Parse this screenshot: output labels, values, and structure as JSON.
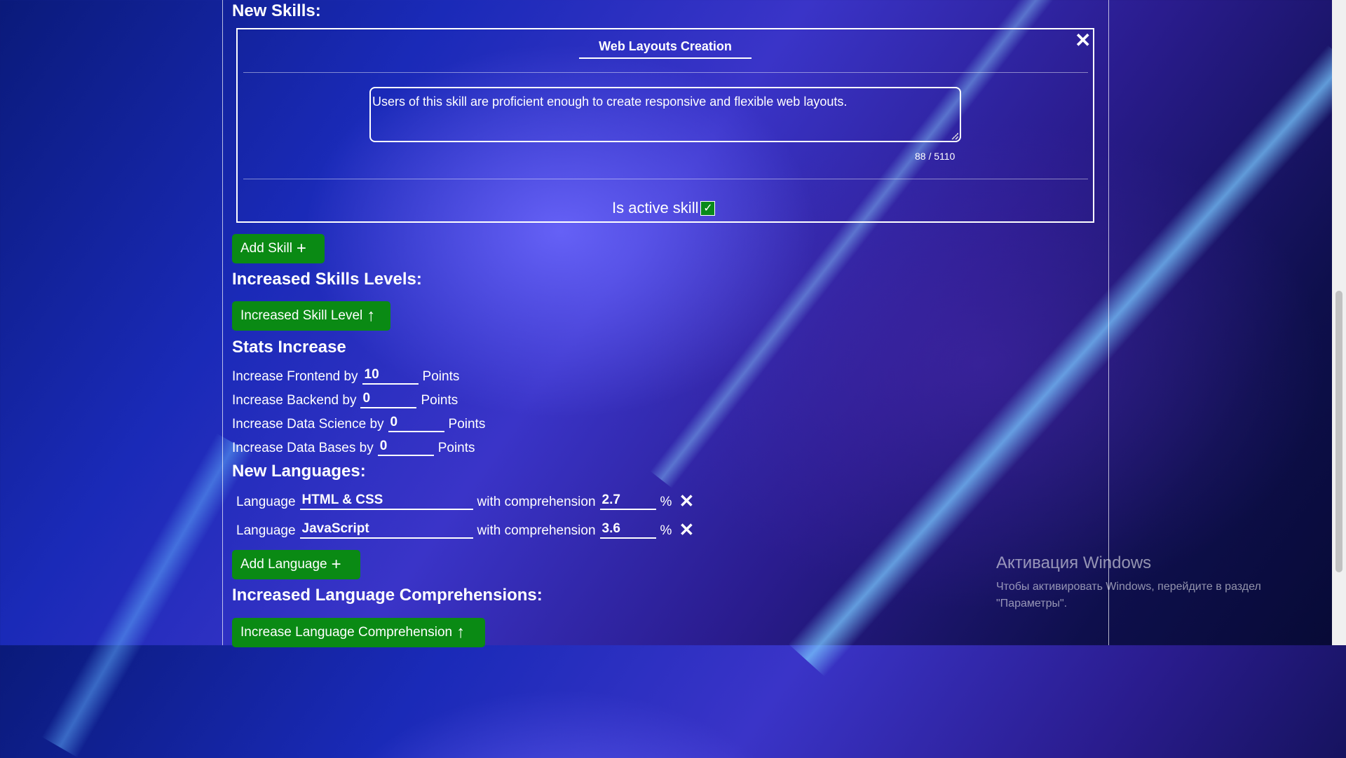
{
  "sections": {
    "new_skills": "New Skills:",
    "increased_skills_levels": "Increased Skills Levels:",
    "stats_increase": "Stats Increase",
    "new_languages": "New Languages:",
    "increased_language_comprehensions": "Increased Language Comprehensions:"
  },
  "skill_card": {
    "name": "Web Layouts Creation",
    "description": "Users of this skill are proficient enough to create responsive and flexible web layouts.",
    "counter": "88 / 5110",
    "active_label": "Is active skill",
    "active_checked": true
  },
  "buttons": {
    "add_skill": "Add Skill",
    "increased_skill_level": "Increased Skill Level",
    "add_language": "Add Language",
    "increase_language_comprehension": "Increase Language Comprehension"
  },
  "stats": [
    {
      "label": "Increase Frontend by",
      "value": "10",
      "suffix": "Points"
    },
    {
      "label": "Increase Backend by",
      "value": "0",
      "suffix": "Points"
    },
    {
      "label": "Increase Data Science by",
      "value": "0",
      "suffix": "Points"
    },
    {
      "label": "Increase Data Bases by",
      "value": "0",
      "suffix": "Points"
    }
  ],
  "languages": [
    {
      "prefix": "Language",
      "name": "HTML & CSS",
      "mid": "with comprehension",
      "value": "2.7",
      "unit": "%"
    },
    {
      "prefix": "Language",
      "name": "JavaScript",
      "mid": "with comprehension",
      "value": "3.6",
      "unit": "%"
    }
  ],
  "watermark": {
    "title": "Активация Windows",
    "line1": "Чтобы активировать Windows, перейдите в раздел",
    "line2": "\"Параметры\"."
  },
  "icons": {
    "close": "close-icon",
    "plus": "plus-icon",
    "arrow_up": "arrow-up-icon",
    "check": "checkmark-icon"
  },
  "colors": {
    "button_green": "#0a8a14",
    "background_blue": "#2a2ab8"
  }
}
